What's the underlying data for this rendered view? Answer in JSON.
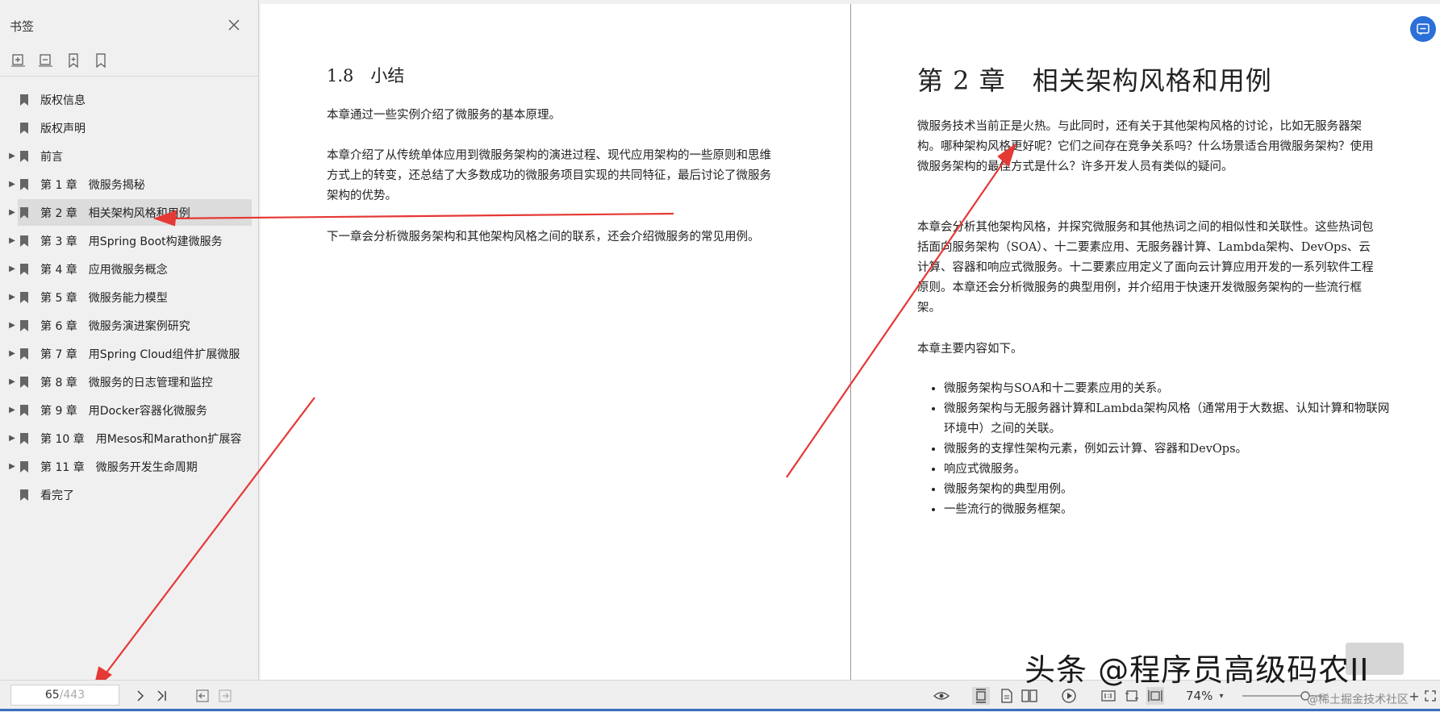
{
  "sidebar": {
    "title": "书签",
    "close_icon": "close-icon",
    "toolbar": [
      "expand-all-icon",
      "collapse-all-icon",
      "add-bookmark-icon",
      "bookmark-icon"
    ],
    "items": [
      {
        "label": "版权信息",
        "expandable": false,
        "selected": false
      },
      {
        "label": "版权声明",
        "expandable": false,
        "selected": false
      },
      {
        "label": "前言",
        "expandable": true,
        "selected": false
      },
      {
        "label": "第 1 章　微服务揭秘",
        "expandable": true,
        "selected": false
      },
      {
        "label": "第 2 章　相关架构风格和用例",
        "expandable": true,
        "selected": true
      },
      {
        "label": "第 3 章　用Spring Boot构建微服务",
        "expandable": true,
        "selected": false
      },
      {
        "label": "第 4 章　应用微服务概念",
        "expandable": true,
        "selected": false
      },
      {
        "label": "第 5 章　微服务能力模型",
        "expandable": true,
        "selected": false
      },
      {
        "label": "第 6 章　微服务演进案例研究",
        "expandable": true,
        "selected": false
      },
      {
        "label": "第 7 章　用Spring Cloud组件扩展微服",
        "expandable": true,
        "selected": false
      },
      {
        "label": "第 8 章　微服务的日志管理和监控",
        "expandable": true,
        "selected": false
      },
      {
        "label": "第 9 章　用Docker容器化微服务",
        "expandable": true,
        "selected": false
      },
      {
        "label": "第 10 章　用Mesos和Marathon扩展容",
        "expandable": true,
        "selected": false
      },
      {
        "label": "第 11 章　微服务开发生命周期",
        "expandable": true,
        "selected": false
      },
      {
        "label": "看完了",
        "expandable": false,
        "selected": false
      }
    ]
  },
  "left_page": {
    "section_title": "1.8　小结",
    "paragraphs": [
      "本章通过一些实例介绍了微服务的基本原理。",
      "本章介绍了从传统单体应用到微服务架构的演进过程、现代应用架构的一些原则和思维方式上的转变，还总结了大多数成功的微服务项目实现的共同特征，最后讨论了微服务架构的优势。",
      "下一章会分析微服务架构和其他架构风格之间的联系，还会介绍微服务的常见用例。"
    ]
  },
  "right_page": {
    "chapter_title": "第 2 章　相关架构风格和用例",
    "paragraphs": [
      "微服务技术当前正是火热。与此同时，还有关于其他架构风格的讨论，比如无服务器架构。哪种架构风格更好呢？它们之间存在竞争关系吗？什么场景适合用微服务架构？使用微服务架构的最佳方式是什么？许多开发人员有类似的疑问。",
      "本章会分析其他架构风格，并探究微服务和其他热词之间的相似性和关联性。这些热词包括面向服务架构（SOA）、十二要素应用、无服务器计算、Lambda架构、DevOps、云计算、容器和响应式微服务。十二要素应用定义了面向云计算应用开发的一系列软件工程原则。本章还会分析微服务的典型用例，并介绍用于快速开发微服务架构的一些流行框架。",
      "本章主要内容如下。"
    ],
    "bullets": [
      "微服务架构与SOA和十二要素应用的关系。",
      "微服务架构与无服务器计算和Lambda架构风格（通常用于大数据、认知计算和物联网环境中）之间的关联。",
      "微服务的支撑性架构元素，例如云计算、容器和DevOps。",
      "响应式微服务。",
      "微服务架构的典型用例。",
      "一些流行的微服务框架。"
    ]
  },
  "bottom_bar": {
    "page_current": "65",
    "page_total": "/443",
    "zoom": "74%"
  },
  "watermark": {
    "main": "头条 @程序员高级码农II",
    "small": "@稀土掘金技术社区"
  },
  "colors": {
    "arrow": "#e53935",
    "accent": "#2b6fd8"
  }
}
